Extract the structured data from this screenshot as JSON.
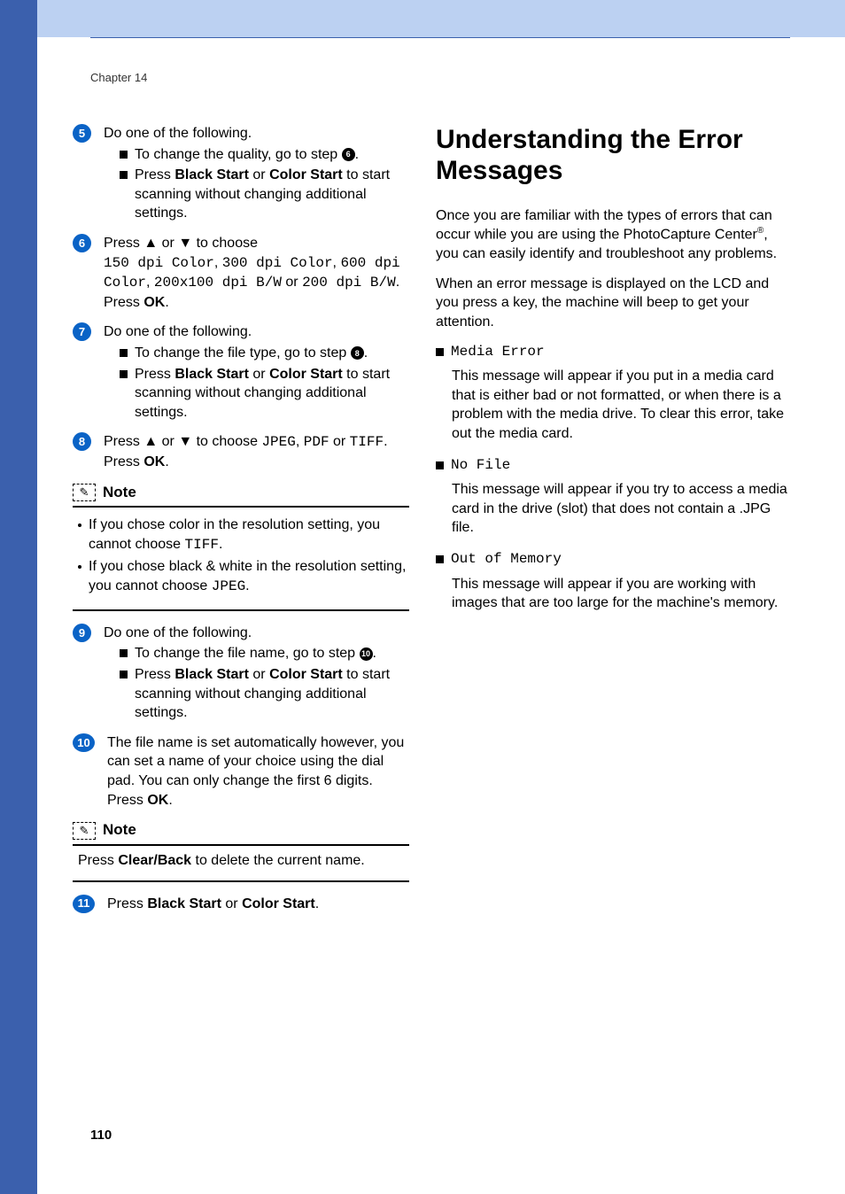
{
  "chapter": "Chapter 14",
  "page_number": "110",
  "left": {
    "s5": {
      "intro": "Do one of the following.",
      "a_before": "To change the quality, go to step ",
      "a_ref": "6",
      "a_after": ".",
      "b_pre": "Press ",
      "b_bs": "Black Start",
      "b_or": " or ",
      "b_cs": "Color Start",
      "b_post": " to start scanning without changing additional settings."
    },
    "s6": {
      "pre": "Press ",
      "up": "▲",
      "or1": " or ",
      "down": "▼",
      "mid": " to choose ",
      "opt1": "150 dpi Color",
      "c1": ", ",
      "opt2": "300 dpi Color",
      "c2": ", ",
      "opt3": "600 dpi Color",
      "c3": ", ",
      "opt4": "200x100 dpi B/W",
      "or2": " or ",
      "opt5": "200 dpi B/W",
      "dot": ".",
      "press": "Press ",
      "ok": "OK",
      "dot2": "."
    },
    "s7": {
      "intro": "Do one of the following.",
      "a_before": "To change the file type, go to step ",
      "a_ref": "8",
      "a_after": ".",
      "b_pre": "Press ",
      "b_bs": "Black Start",
      "b_or": " or ",
      "b_cs": "Color Start",
      "b_post": " to start scanning without changing additional settings."
    },
    "s8": {
      "pre": "Press ",
      "up": "▲",
      "or1": " or ",
      "down": "▼",
      "mid": " to choose ",
      "o1": "JPEG",
      "c1": ", ",
      "o2": "PDF",
      "or2": " or ",
      "o3": "TIFF",
      "dot": ".",
      "press": "Press ",
      "ok": "OK",
      "dot2": "."
    },
    "note1": {
      "title": "Note",
      "l1a": "If you chose color in the resolution setting, you cannot choose ",
      "l1b": "TIFF",
      "l1c": ".",
      "l2a": "If you chose black & white in the resolution setting, you cannot choose ",
      "l2b": "JPEG",
      "l2c": "."
    },
    "s9": {
      "intro": "Do one of the following.",
      "a_before": "To change the file name, go to step ",
      "a_ref": "10",
      "a_after": ".",
      "b_pre": "Press ",
      "b_bs": "Black Start",
      "b_or": " or ",
      "b_cs": "Color Start",
      "b_post": " to start scanning without changing additional settings."
    },
    "s10": {
      "body": "The file name is set automatically however, you can set a name of your choice using the dial pad. You can only change the first 6 digits.",
      "press": "Press ",
      "ok": "OK",
      "dot": "."
    },
    "note2": {
      "title": "Note",
      "pre": "Press ",
      "cb": "Clear/Back",
      "post": " to delete the current name."
    },
    "s11": {
      "pre": "Press ",
      "bs": "Black Start",
      "or": " or ",
      "cs": "Color Start",
      "dot": "."
    }
  },
  "right": {
    "heading": "Understanding the Error Messages",
    "p1a": "Once you are familiar with the types of errors that can occur while you are using the PhotoCapture Center",
    "reg": "®",
    "p1b": ", you can easily identify and troubleshoot any problems.",
    "p2": "When an error message is displayed on the LCD and you press a key, the machine will beep to get your attention.",
    "errors": {
      "e1": {
        "name": "Media Error",
        "body": "This message will appear if you put in a media card that is either bad or not formatted, or when there is a problem with the media drive. To clear this error, take out the media card."
      },
      "e2": {
        "name": "No File",
        "body": "This message will appear if you try to access a media card in the drive (slot) that does not contain a .JPG file."
      },
      "e3": {
        "name": "Out of Memory",
        "body": "This message will appear if you are working with images that are too large for the machine's memory."
      }
    }
  }
}
